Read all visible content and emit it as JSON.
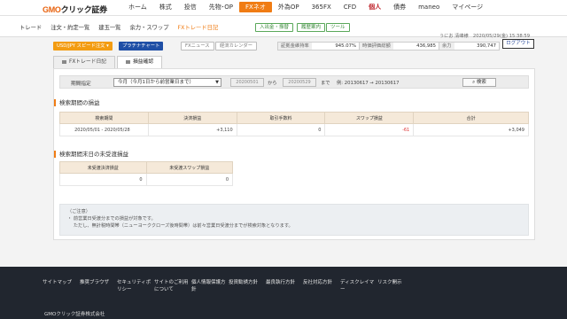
{
  "header": {
    "logo_brand": "GMO",
    "logo_rest": "クリック証券",
    "nav": [
      {
        "label": "ホーム",
        "name": "nav-home"
      },
      {
        "label": "株式",
        "name": "nav-stocks"
      },
      {
        "label": "投信",
        "name": "nav-funds"
      },
      {
        "label": "先物･OP",
        "name": "nav-futures"
      },
      {
        "label": "FXネオ",
        "name": "nav-fx",
        "active": true
      },
      {
        "label": "外為OP",
        "name": "nav-fx-options"
      },
      {
        "label": "365FX",
        "name": "nav-365fx"
      },
      {
        "label": "CFD",
        "name": "nav-cfd"
      },
      {
        "label": "個人",
        "name": "nav-personal",
        "danger": true
      },
      {
        "label": "債券",
        "name": "nav-bonds"
      },
      {
        "label": "maneo",
        "name": "nav-maneo"
      },
      {
        "label": "マイページ",
        "name": "nav-mypage"
      }
    ]
  },
  "subnav": {
    "items": [
      "トレード",
      "注文・約定一覧",
      "建玉一覧",
      "余力・スワップ",
      "FXトレード日記"
    ],
    "highlight_index": 4,
    "pills": [
      "入出金・振替",
      "履歴案内",
      "ツール"
    ],
    "user_line": "うにお 清峰様　2020/05/29(金) 15:38:59",
    "logout": "ログアウト"
  },
  "toolbar": {
    "orange_label": "USD/JPY スピード注文 ▾",
    "blue_label": "プラチナチャート",
    "fx_news": "FXニュース",
    "econ_calendar": "経済カレンダー",
    "metrics": [
      {
        "label": "証拠金維持率",
        "value": "945.07%"
      },
      {
        "label": "時価評価総額",
        "value": "436,985"
      },
      {
        "label": "余力",
        "value": "390,747"
      }
    ]
  },
  "tabs": [
    {
      "label": "FXトレード日記",
      "active": false
    },
    {
      "label": "損益確認",
      "active": true
    }
  ],
  "filter": {
    "label": "期間指定",
    "select_value": "今月（今月1日から前営業日まで）",
    "date_from": "20200501",
    "from_text": "から",
    "date_to": "20200529",
    "to_text": "まで",
    "range_note": "例: 20130617 → 20130617",
    "search": "検索"
  },
  "period_pl": {
    "title": "検索期間の損益",
    "headers": [
      "検索期間",
      "決済損益",
      "取引手数料",
      "スワップ損益",
      "合計"
    ],
    "row": [
      "2020/05/01 - 2020/05/28",
      "+3,110",
      "0",
      "-61",
      "+3,049"
    ]
  },
  "unrealized": {
    "title": "検索期間末日の未受渡損益",
    "headers": [
      "未受渡決済損益",
      "未受渡スワップ損益"
    ],
    "row": [
      "0",
      "0"
    ]
  },
  "note": {
    "title": "（ご注意）",
    "lines": [
      "・ 前営業日受渡分までの損益が対象です。",
      "　 ただし、無計税時間帯（ニューヨーククローズ後時間帯）は前々営業日受渡分までが検索対象となります。"
    ]
  },
  "footer": {
    "links": [
      "サイトマップ",
      "推奨ブラウザ",
      "セキュリティポリシー",
      "サイトのご利用について",
      "個人情報保護方針",
      "投資勧誘方針",
      "最良執行方針",
      "反社対応方針",
      "ディスクレイマー",
      "リスク開示"
    ],
    "copyright": "GMOクリック証券株式会社"
  }
}
